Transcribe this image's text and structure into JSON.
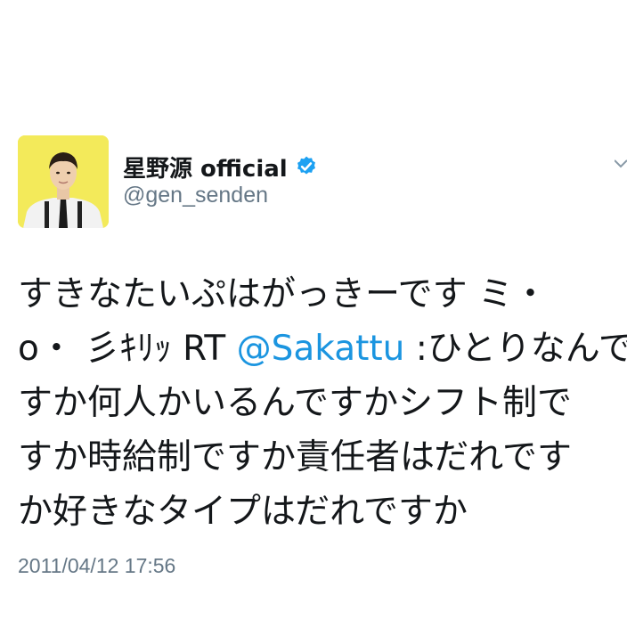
{
  "user": {
    "display_name": "星野源 official",
    "handle": "@gen_senden",
    "verified": true,
    "avatar_bg": "#f3ea5a"
  },
  "tweet": {
    "lines": [
      {
        "text": "すきなたいぷはがっきーです ミ・"
      },
      {
        "prefix": "o・ 彡ｷﾘｯ RT ",
        "mention": "@Sakattu",
        "suffix": " :ひとりなんで"
      },
      {
        "text": "すか何人かいるんですかシフト制で"
      },
      {
        "text": "すか時給制ですか責任者はだれです"
      },
      {
        "text": "か好きなタイプはだれですか"
      }
    ],
    "timestamp": "2011/04/12 17:56"
  },
  "colors": {
    "mention": "#1b95e0",
    "secondary_text": "#657786",
    "verified_badge": "#1da1f2"
  },
  "icons": {
    "verified": "verified-badge-icon",
    "menu": "chevron-down-icon"
  }
}
